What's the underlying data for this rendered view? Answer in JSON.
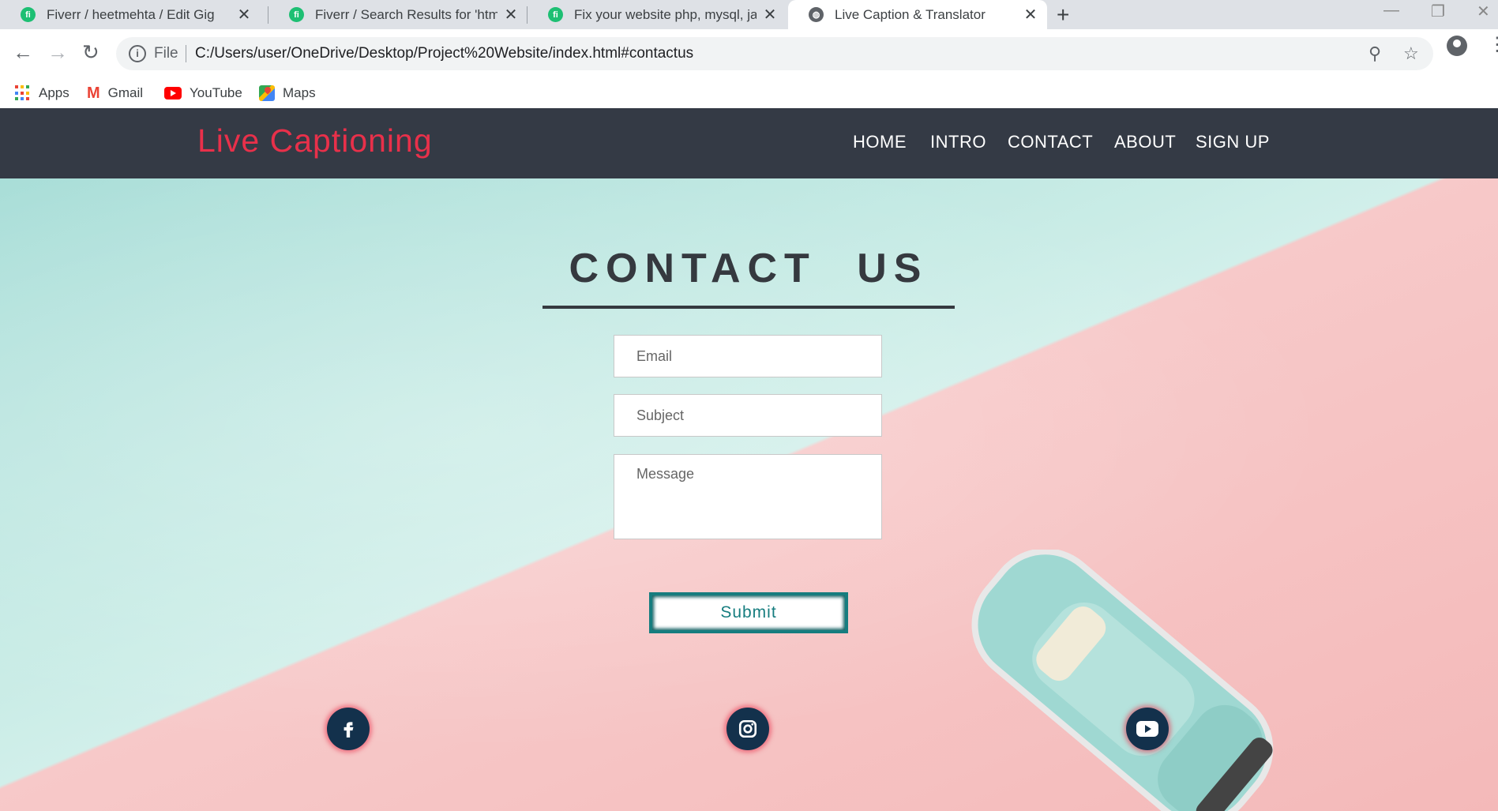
{
  "browser": {
    "tabs": [
      {
        "title": "Fiverr / heetmehta / Edit Gig",
        "favicon": "fiverr-icon",
        "active": false
      },
      {
        "title": "Fiverr / Search Results for 'html e",
        "favicon": "fiverr-icon",
        "active": false
      },
      {
        "title": "Fix your website php, mysql, java",
        "favicon": "fiverr-icon",
        "active": false
      },
      {
        "title": "Live Caption & Translator",
        "favicon": "globe-icon",
        "active": true
      }
    ],
    "address_bar": {
      "scheme_label": "File",
      "url": "C:/Users/user/OneDrive/Desktop/Project%20Website/index.html#contactus"
    },
    "bookmarks": [
      {
        "label": "Apps",
        "icon": "apps-grid-icon"
      },
      {
        "label": "Gmail",
        "icon": "gmail-icon"
      },
      {
        "label": "YouTube",
        "icon": "youtube-icon"
      },
      {
        "label": "Maps",
        "icon": "maps-icon"
      }
    ]
  },
  "site": {
    "brand": "Live Captioning",
    "nav": [
      "HOME",
      "INTRO",
      "CONTACT",
      "ABOUT",
      "SIGN UP"
    ],
    "contact": {
      "title": "CONTACT US",
      "email_placeholder": "Email",
      "subject_placeholder": "Subject",
      "message_placeholder": "Message",
      "submit_label": "Submit"
    },
    "social": [
      "facebook-icon",
      "instagram-icon",
      "youtube-icon"
    ]
  },
  "colors": {
    "nav_bg": "#343a45",
    "brand": "#e8304a",
    "teal_bg": "#c9ece6",
    "pink_bg": "#f4b9b9",
    "submit_border": "#167d7f",
    "social_bg": "#13314c"
  }
}
